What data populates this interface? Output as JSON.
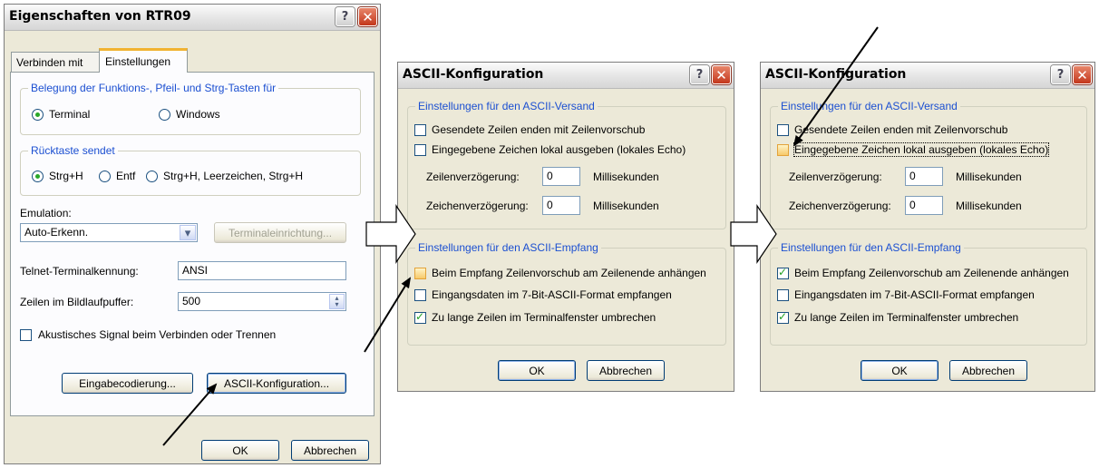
{
  "dialog1": {
    "title": "Eigenschaften von RTR09",
    "tabs": [
      "Verbinden mit",
      "Einstellungen"
    ],
    "group_keys": {
      "legend": "Belegung der Funktions-, Pfeil- und Strg-Tasten für",
      "terminal": "Terminal",
      "windows": "Windows"
    },
    "group_back": {
      "legend": "Rücktaste sendet",
      "strgh": "Strg+H",
      "entf": "Entf",
      "combo": "Strg+H, Leerzeichen, Strg+H"
    },
    "emulation_label": "Emulation:",
    "emulation_value": "Auto-Erkenn.",
    "terminal_setup_btn": "Terminaleinrichtung...",
    "telnet_label": "Telnet-Terminalkennung:",
    "telnet_value": "ANSI",
    "scroll_label": "Zeilen im Bildlaufpuffer:",
    "scroll_value": "500",
    "beep_label": "Akustisches Signal beim Verbinden oder Trennen",
    "input_encoding_btn": "Eingabecodierung...",
    "ascii_config_btn": "ASCII-Konfiguration...",
    "ok": "OK",
    "cancel": "Abbrechen"
  },
  "dialog2": {
    "title": "ASCII-Konfiguration",
    "send_legend": "Einstellungen für den ASCII-Versand",
    "send_cr": "Gesendete Zeilen enden mit Zeilenvorschub",
    "echo": "Eingegebene Zeichen lokal ausgeben (lokales Echo)",
    "line_delay_label": "Zeilenverzögerung:",
    "line_delay_value": "0",
    "char_delay_label": "Zeichenverzögerung:",
    "char_delay_value": "0",
    "ms": "Millisekunden",
    "recv_legend": "Einstellungen für den ASCII-Empfang",
    "recv_lf": "Beim Empfang Zeilenvorschub am Zeilenende anhängen",
    "seven_bit": "Eingangsdaten im 7-Bit-ASCII-Format empfangen",
    "wrap": "Zu lange Zeilen im Terminalfenster umbrechen",
    "ok": "OK",
    "cancel": "Abbrechen"
  },
  "dialog3": {
    "title": "ASCII-Konfiguration",
    "send_legend": "Einstellungen für den ASCII-Versand",
    "send_cr": "Gesendete Zeilen enden mit Zeilenvorschub",
    "echo": "Eingegebene Zeichen lokal ausgeben (lokales Echo)",
    "line_delay_label": "Zeilenverzögerung:",
    "line_delay_value": "0",
    "char_delay_label": "Zeichenverzögerung:",
    "char_delay_value": "0",
    "ms": "Millisekunden",
    "recv_legend": "Einstellungen für den ASCII-Empfang",
    "recv_lf": "Beim Empfang Zeilenvorschub am Zeilenende anhängen",
    "seven_bit": "Eingangsdaten im 7-Bit-ASCII-Format empfangen",
    "wrap": "Zu lange Zeilen im Terminalfenster umbrechen",
    "ok": "OK",
    "cancel": "Abbrechen"
  },
  "icons": {
    "help": "?",
    "close": "✕",
    "dropdown": "▾",
    "spin_up": "▴",
    "spin_down": "▾"
  },
  "colors": {
    "legend_blue": "#1b4fd1",
    "dialog_bg": "#ece9d8",
    "close_red": "#c3371c",
    "check_green": "#21a121"
  }
}
